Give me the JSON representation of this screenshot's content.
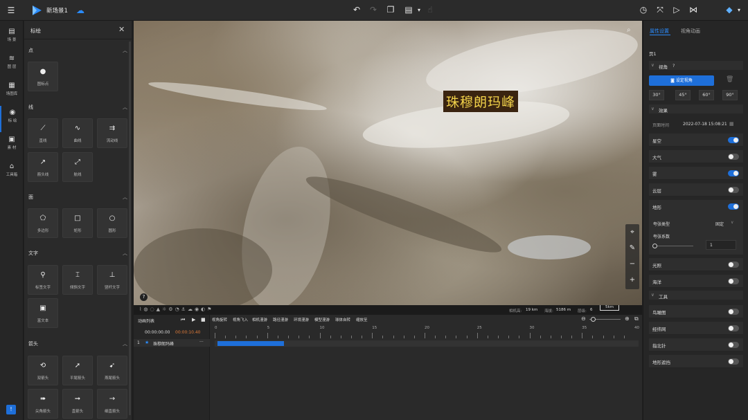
{
  "topbar": {
    "scene_name": "新场景1",
    "icons": [
      "menu-icon",
      "logo-icon",
      "cloud-icon",
      "undo-icon",
      "redo-icon",
      "layers-copy-icon",
      "screen-icon",
      "hand-icon",
      "clock-icon",
      "fullscreen-icon",
      "play-icon",
      "share-icon",
      "avatar-icon"
    ]
  },
  "nav": [
    {
      "icon": "▤",
      "label": "场 景"
    },
    {
      "icon": "≋",
      "label": "图 层"
    },
    {
      "icon": "▦",
      "label": "场图库"
    },
    {
      "icon": "◉",
      "label": "标 绘"
    },
    {
      "icon": "▣",
      "label": "素 材"
    },
    {
      "icon": "⌂",
      "label": "工具箱"
    }
  ],
  "panel": {
    "title": "标绘",
    "sections": {
      "point": "点",
      "line": "线",
      "surface": "面",
      "text": "文字",
      "arrow": "箭头"
    },
    "tools": {
      "point_marker": "图标点",
      "line_straight": "直线",
      "line_curve": "曲线",
      "line_flow": "流动线",
      "line_arrow": "箭头线",
      "line_route": "航线",
      "poly_polygon": "多边形",
      "poly_rect": "矩形",
      "poly_circle": "圆形",
      "text_label": "标签文字",
      "text_tilt": "倾斜文字",
      "text_stick": "竖杆文字",
      "text_rich": "富文本",
      "arrow_double": "双箭头",
      "arrow_flat": "平尾箭头",
      "arrow_tail": "燕尾箭头",
      "arrow_sharp": "尖角箭头",
      "arrow_straight": "直箭头",
      "arrow_thin": "细直箭头"
    }
  },
  "viewport": {
    "label": "珠穆朗玛峰",
    "help": "?"
  },
  "statusbar": {
    "altitude_label": "相机高:",
    "altitude_value": "19 km",
    "sea_label": "海拔:",
    "sea_value": "5186 m",
    "level_label": "层级:",
    "level_value": "6",
    "scale": "5km"
  },
  "timeline": {
    "list_title": "动画列表",
    "tabs": [
      "视角旋转",
      "视角飞入",
      "相机漫游",
      "路径漫游",
      "环境漫游",
      "模型漫游",
      "球体自转",
      "缩放至"
    ],
    "time_current": "00:00:00.00",
    "time_total": "00:00:10.40",
    "ticks": [
      "0",
      "5",
      "10",
      "15",
      "20",
      "25",
      "30",
      "35",
      "40"
    ],
    "track_index": "1",
    "track_name": "珠穆朗玛峰",
    "track_progress": 0.27,
    "more": "···"
  },
  "right": {
    "tabs": [
      "属性设置",
      "视角动画"
    ],
    "page": "页1",
    "view_section": "视角",
    "view_help": "?",
    "set_view_button": "设定视角",
    "angles": [
      "30°",
      "45°",
      "60°",
      "90°"
    ],
    "effects_section": "效果",
    "time_label": "页面时间",
    "time_value": "2022-07-18 15:08:21",
    "toggles": [
      {
        "label": "星空",
        "on": true
      },
      {
        "label": "大气",
        "on": false
      },
      {
        "label": "雾",
        "on": true
      },
      {
        "label": "云层",
        "on": false
      },
      {
        "label": "地形",
        "on": true
      }
    ],
    "exag_type_label": "夸张类型",
    "exag_type_value": "固定",
    "exag_factor_label": "夸张系数",
    "exag_factor_value": "1",
    "toggles2": [
      {
        "label": "光照",
        "on": false
      },
      {
        "label": "海洋",
        "on": false
      }
    ],
    "tools_section": "工具",
    "toggles3": [
      {
        "label": "鸟瞰图",
        "on": false
      },
      {
        "label": "经纬网",
        "on": false
      },
      {
        "label": "指北针",
        "on": false
      },
      {
        "label": "地形遮挡",
        "on": false
      }
    ]
  },
  "colors": {
    "accent": "#1e6fd9",
    "label_bg": "#3a2410",
    "label_fg": "#f2d24a"
  }
}
